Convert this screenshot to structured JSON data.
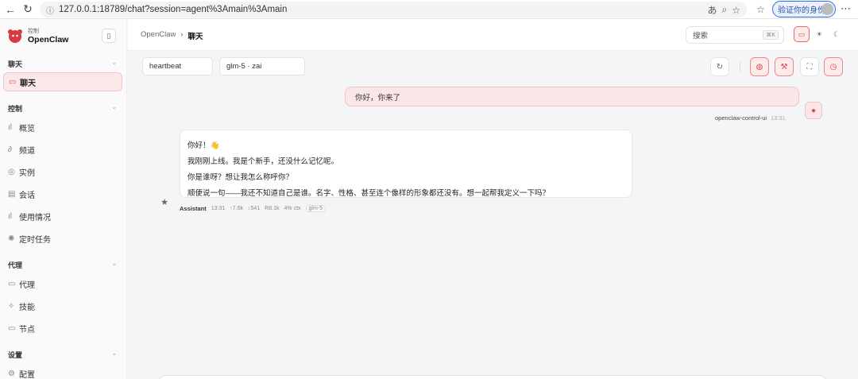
{
  "browser": {
    "url": "127.0.0.1:18789/chat?session=agent%3Amain%3Amain",
    "profile_label": "验证你的身份"
  },
  "brand": {
    "small_label": "控制",
    "name": "OpenClaw"
  },
  "sidebar": {
    "sections": [
      {
        "label": "聊天"
      },
      {
        "label": "控制"
      },
      {
        "label": "代理"
      },
      {
        "label": "设置"
      }
    ],
    "items": [
      {
        "label": "聊天",
        "icon": "chat-icon"
      },
      {
        "label": "概览",
        "icon": "bar-chart-icon"
      },
      {
        "label": "频道",
        "icon": "link-icon"
      },
      {
        "label": "实例",
        "icon": "broadcast-icon"
      },
      {
        "label": "会话",
        "icon": "document-icon"
      },
      {
        "label": "使用情况",
        "icon": "bar-chart-icon"
      },
      {
        "label": "定时任务",
        "icon": "spinner-icon"
      },
      {
        "label": "代理",
        "icon": "folder-icon"
      },
      {
        "label": "技能",
        "icon": "sparkle-icon"
      },
      {
        "label": "节点",
        "icon": "monitor-icon"
      },
      {
        "label": "配置",
        "icon": "gear-icon"
      }
    ]
  },
  "topbar": {
    "breadcrumb_root": "OpenClaw",
    "breadcrumb_current": "聊天",
    "search_placeholder": "搜索",
    "search_shortcut": "⌘K"
  },
  "chat": {
    "session_chip": "heartbeat",
    "model_chip": "glm-5 · zai",
    "user_message": "你好，你来了",
    "user_name": "openclaw-control-ui",
    "user_time": "13:31",
    "assistant_lines": [
      "你好！👋",
      "我刚刚上线。我是个新手，还没什么记忆呢。",
      "你是谁呀？想让我怎么称呼你？",
      "顺便说一句——我还不知道自己是谁。名字、性格、甚至连个像样的形象都还没有。想一起帮我定义一下吗？"
    ],
    "assistant_meta": {
      "name": "Assistant",
      "time": "13:31",
      "tokens_in": "↑7.6k",
      "tokens_out": "↓541",
      "cache": "R8.1k",
      "ctx": "4% ctx",
      "model": "glm-5"
    }
  },
  "colors": {
    "accent": "#d94a4f",
    "accent_bg": "#fbe6e7"
  }
}
